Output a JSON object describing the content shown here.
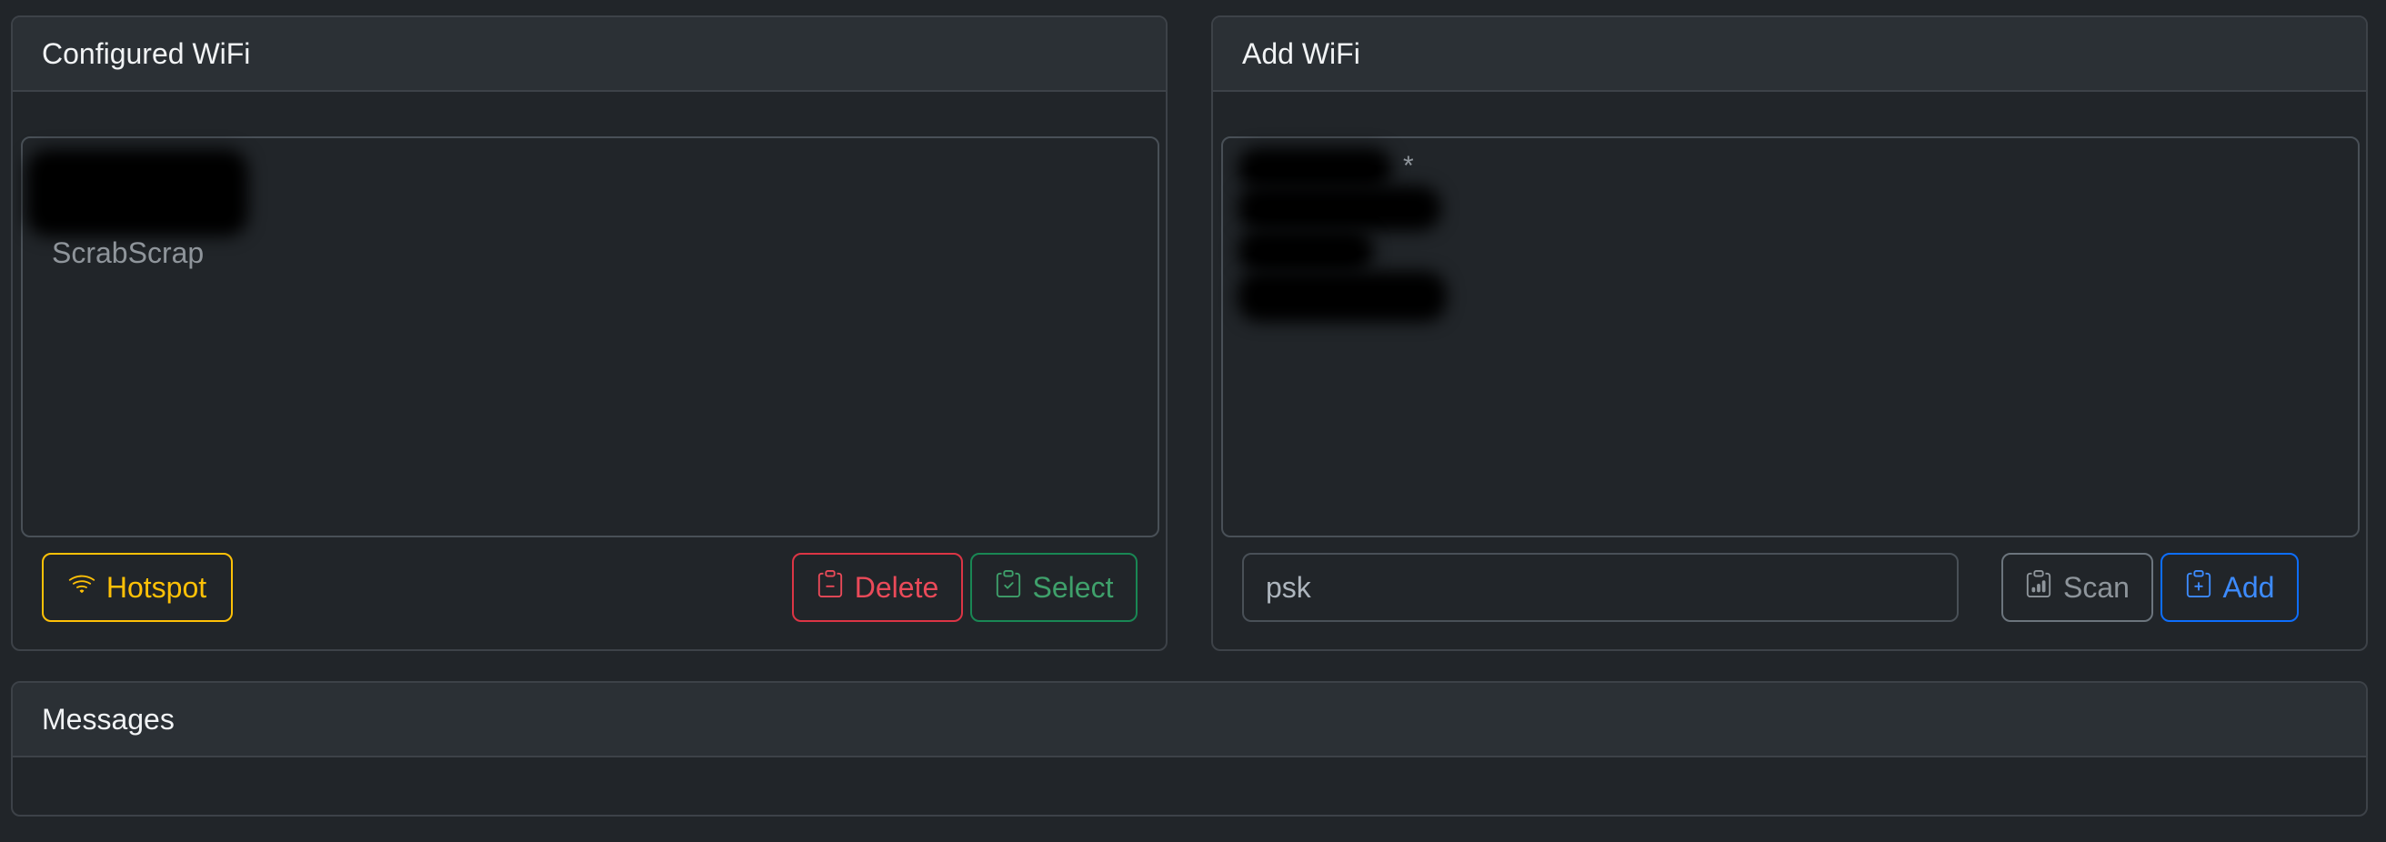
{
  "configured": {
    "title": "Configured WiFi",
    "networks": [
      "ScrabScrap"
    ],
    "buttons": {
      "hotspot": "Hotspot",
      "delete": "Delete",
      "select": "Select"
    }
  },
  "add": {
    "title": "Add WiFi",
    "scan_marker": "*",
    "psk_placeholder": "psk",
    "buttons": {
      "scan": "Scan",
      "add": "Add"
    }
  },
  "messages": {
    "title": "Messages"
  },
  "colors": {
    "background": "#212529",
    "warning": "#ffc107",
    "danger": "#dc3545",
    "success": "#198754",
    "secondary": "#6c757d",
    "primary": "#0d6efd"
  },
  "icons": {
    "hotspot": "wifi-icon",
    "delete": "clipboard-minus-icon",
    "select": "clipboard-check-icon",
    "scan": "clipboard-data-icon",
    "add": "clipboard-plus-icon"
  }
}
